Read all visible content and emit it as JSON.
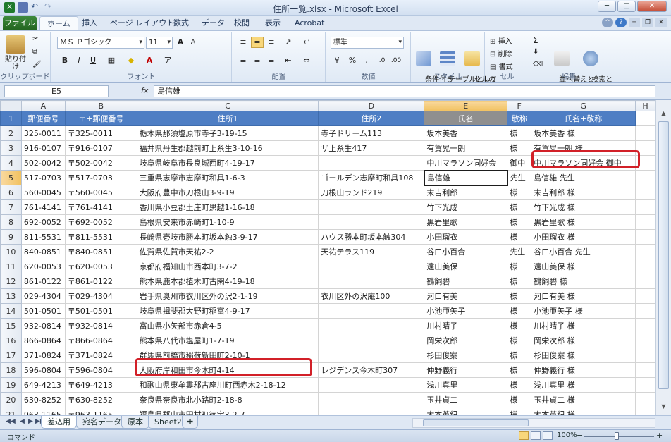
{
  "window": {
    "title": "住所一覧.xlsx - Microsoft Excel"
  },
  "tabs": [
    "ファイル",
    "ホーム",
    "挿入",
    "ページ レイアウト",
    "数式",
    "データ",
    "校閲",
    "表示",
    "Acrobat"
  ],
  "active_tab": "ホーム",
  "ribbon": {
    "clipboard": {
      "paste": "貼り付け",
      "label": "クリップボード"
    },
    "font": {
      "name": "ＭＳ Ｐゴシック",
      "size": "11",
      "label": "フォント",
      "bold": "B",
      "italic": "I",
      "underline": "U",
      "grow": "A",
      "shrink": "A"
    },
    "alignment": {
      "label": "配置"
    },
    "number": {
      "format": "標準",
      "label": "数値",
      "currency": "%",
      "comma": ",",
      "inc": ".0",
      "dec": ".00"
    },
    "styles": {
      "conditional": "条件付き\n書式",
      "table": "テーブルとして\n書式設定",
      "cell": "セルの\nスタイル",
      "label": "スタイル"
    },
    "cells": {
      "insert": "挿入",
      "delete": "削除",
      "format": "書式",
      "label": "セル"
    },
    "editing": {
      "sort": "並べ替えと\nフィルター",
      "find": "検索と\n選択",
      "label": "編集",
      "sigma": "Σ"
    }
  },
  "formula_bar": {
    "name_box": "E5",
    "fx": "fx",
    "value": "島信雄"
  },
  "columns": [
    "A",
    "B",
    "C",
    "D",
    "E",
    "F",
    "G"
  ],
  "header_row": [
    "郵便番号",
    "〒+郵便番号",
    "住所1",
    "住所2",
    "氏名",
    "敬称",
    "氏名+敬称"
  ],
  "rows": [
    [
      "325-0011",
      "〒325-0011",
      "栃木県那須塩原市寺子3-19-15",
      "寺子ドリーム113",
      "坂本美香",
      "様",
      "坂本美香 様"
    ],
    [
      "916-0107",
      "〒916-0107",
      "福井県丹生郡越前町上糸生3-10-16",
      "ザ上糸生417",
      "有賀晃一朗",
      "様",
      "有賀晃一朗 様"
    ],
    [
      "502-0042",
      "〒502-0042",
      "岐阜県岐阜市長良城西町4-19-17",
      "",
      "中川マラソン同好会",
      "御中",
      "中川マラソン同好会 御中"
    ],
    [
      "517-0703",
      "〒517-0703",
      "三重県志摩市志摩町和具1-6-3",
      "ゴールデン志摩町和具108",
      "島信雄",
      "先生",
      "島信雄 先生"
    ],
    [
      "560-0045",
      "〒560-0045",
      "大阪府豊中市刀根山3-9-19",
      "刀根山ランド219",
      "末吉利郎",
      "様",
      "末吉利郎 様"
    ],
    [
      "761-4141",
      "〒761-4141",
      "香川県小豆郡土庄町黒越1-16-18",
      "",
      "竹下光成",
      "様",
      "竹下光成 様"
    ],
    [
      "692-0052",
      "〒692-0052",
      "島根県安来市赤崎町1-10-9",
      "",
      "黒岩里歌",
      "様",
      "黒岩里歌 様"
    ],
    [
      "811-5531",
      "〒811-5531",
      "長崎県壱岐市勝本町坂本触3-9-17",
      "ハウス勝本町坂本触304",
      "小田瑠衣",
      "様",
      "小田瑠衣 様"
    ],
    [
      "840-0851",
      "〒840-0851",
      "佐賀県佐賀市天祐2-2",
      "天祐テラス119",
      "谷口小百合",
      "先生",
      "谷口小百合 先生"
    ],
    [
      "620-0053",
      "〒620-0053",
      "京都府福知山市西本町3-7-2",
      "",
      "遠山美保",
      "様",
      "遠山美保 様"
    ],
    [
      "861-0122",
      "〒861-0122",
      "熊本県鹿本郡植木町古閑4-19-18",
      "",
      "鶴飼碧",
      "様",
      "鶴飼碧 様"
    ],
    [
      "029-4304",
      "〒029-4304",
      "岩手県奥州市衣川区外の沢2-1-19",
      "衣川区外の沢庵100",
      "河口有美",
      "様",
      "河口有美 様"
    ],
    [
      "501-0501",
      "〒501-0501",
      "岐阜県揖斐郡大野町稲富4-9-17",
      "",
      "小池亜矢子",
      "様",
      "小池亜矢子 様"
    ],
    [
      "932-0814",
      "〒932-0814",
      "富山県小矢部市赤倉4-5",
      "",
      "川村晴子",
      "様",
      "川村晴子 様"
    ],
    [
      "866-0864",
      "〒866-0864",
      "熊本県八代市塩屋町1-7-19",
      "",
      "岡栄次郎",
      "様",
      "岡栄次郎 様"
    ],
    [
      "371-0824",
      "〒371-0824",
      "群馬県前橋市稲荷新田町2-10-1",
      "",
      "杉田俊案",
      "様",
      "杉田俊案 様"
    ],
    [
      "596-0804",
      "〒596-0804",
      "大阪府岸和田市今木町4-14",
      "レジデンス今木町307",
      "仲野義行",
      "様",
      "仲野義行 様"
    ],
    [
      "649-4213",
      "〒649-4213",
      "和歌山県東牟婁郡古座川町西赤木2-18-12",
      "",
      "浅川真里",
      "様",
      "浅川真里 様"
    ],
    [
      "630-8252",
      "〒630-8252",
      "奈良県奈良市北小路町2-18-8",
      "",
      "玉井貞二",
      "様",
      "玉井貞二 様"
    ],
    [
      "963-1165",
      "〒963-1165",
      "福島県郡山市田村町徳定3-2-7",
      "",
      "木本英紀",
      "様",
      "木本英紀 様"
    ]
  ],
  "sheets": [
    "差込用",
    "宛名データ",
    "原本",
    "Sheet2"
  ],
  "active_sheet": "差込用",
  "status": {
    "mode": "コマンド",
    "zoom": "100%"
  },
  "colors": {
    "header_fill": "#4e7ec4",
    "annotation": "#d22028",
    "file_tab": "#2c7a2b"
  }
}
